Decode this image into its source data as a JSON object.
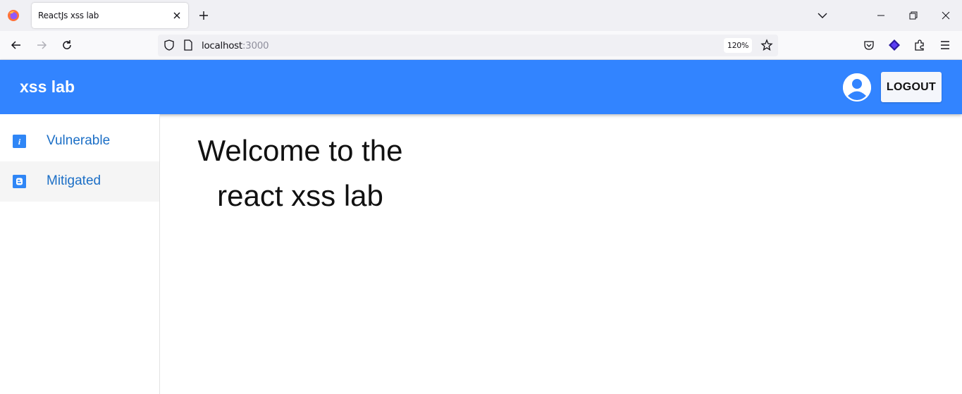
{
  "browser": {
    "tab_title": "ReactJs xss lab",
    "url_host": "localhost",
    "url_port": ":3000",
    "zoom": "120%"
  },
  "header": {
    "brand": "xss lab",
    "logout_label": "LOGOUT",
    "color": "#3284ff"
  },
  "sidebar": {
    "items": [
      {
        "label": "Vulnerable",
        "icon": "info-icon",
        "active": false
      },
      {
        "label": "Mitigated",
        "icon": "blogger-icon",
        "active": true
      }
    ]
  },
  "main": {
    "line1": "Welcome to the",
    "line2": "react xss lab"
  }
}
